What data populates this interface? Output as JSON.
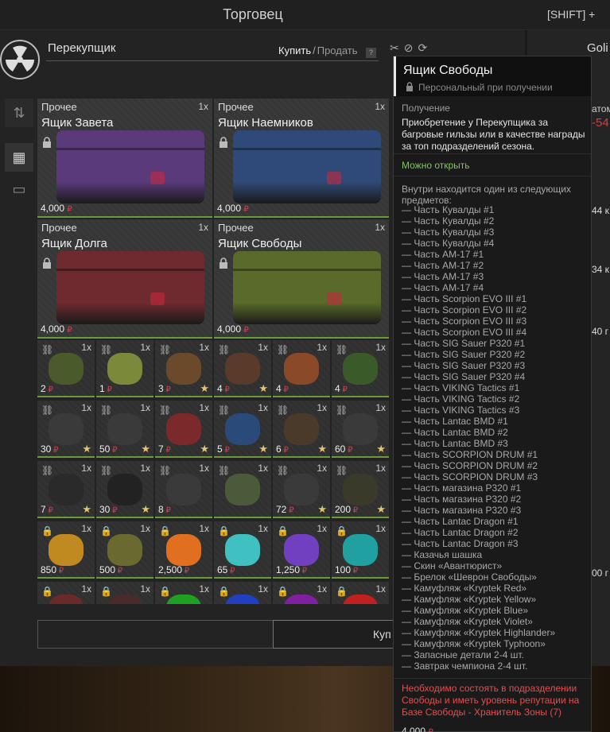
{
  "window": {
    "title": "Торговец",
    "shift_hint": "[SHIFT] +"
  },
  "trader": {
    "name": "Перекупщик",
    "buy": "Купить",
    "slash": "/",
    "sell": "Продать",
    "help": "?"
  },
  "currency_icon": "ruble-sign-icon",
  "big_items": [
    {
      "category": "Прочее",
      "name": "Ящик Завета",
      "qty": "1x",
      "price": "4,000",
      "color": "#5a3a7a"
    },
    {
      "category": "Прочее",
      "name": "Ящик Наемников",
      "qty": "1x",
      "price": "4,000",
      "color": "#2f4a78"
    },
    {
      "category": "Прочее",
      "name": "Ящик Долга",
      "qty": "1x",
      "price": "4,000",
      "color": "#6e2a2e"
    },
    {
      "category": "Прочее",
      "name": "Ящик Свободы",
      "qty": "1x",
      "price": "4,000",
      "color": "#5a6a2a"
    }
  ],
  "small_items": [
    {
      "qty": "1x",
      "price": "2",
      "star": "",
      "color": "#4a5a2a"
    },
    {
      "qty": "1x",
      "price": "1",
      "star": "",
      "color": "#7a8a3a"
    },
    {
      "qty": "1x",
      "price": "3",
      "star": "★",
      "color": "#6a4a2a"
    },
    {
      "qty": "1x",
      "price": "4",
      "star": "★",
      "color": "#5a3a2a"
    },
    {
      "qty": "1x",
      "price": "4",
      "star": "",
      "color": "#8a4a2a"
    },
    {
      "qty": "1x",
      "price": "4",
      "star": "",
      "color": "#3a5a2a"
    },
    {
      "qty": "1x",
      "price": "30",
      "star": "★",
      "color": "#3a3a3a"
    },
    {
      "qty": "1x",
      "price": "50",
      "star": "★",
      "color": "#3a3a3a"
    },
    {
      "qty": "1x",
      "price": "7",
      "star": "★",
      "color": "#7a2a2a"
    },
    {
      "qty": "1x",
      "price": "5",
      "star": "★",
      "color": "#2a4a7a"
    },
    {
      "qty": "1x",
      "price": "6",
      "star": "★",
      "color": "#4a3a2a"
    },
    {
      "qty": "1x",
      "price": "60",
      "star": "★",
      "color": "#3a3a3a"
    },
    {
      "qty": "1x",
      "price": "7",
      "star": "★",
      "color": "#2a2a2a"
    },
    {
      "qty": "1x",
      "price": "30",
      "star": "★",
      "color": "#222222"
    },
    {
      "qty": "1x",
      "price": "8",
      "star": "",
      "color": "#3a3a3a"
    },
    {
      "qty": "1x",
      "price": "",
      "star": "",
      "color": "#4a5a3a"
    },
    {
      "qty": "1x",
      "price": "72",
      "star": "★",
      "color": "#3a3a3a"
    },
    {
      "qty": "1x",
      "price": "200",
      "star": "★",
      "color": "#3a3a2a"
    },
    {
      "qty": "1x",
      "price": "850",
      "star": "",
      "color": "#c08a20"
    },
    {
      "qty": "1x",
      "price": "500",
      "star": "",
      "color": "#6a6a30"
    },
    {
      "qty": "1x",
      "price": "2,500",
      "star": "",
      "color": "#e07020"
    },
    {
      "qty": "1x",
      "price": "65",
      "star": "",
      "color": "#40c0c0"
    },
    {
      "qty": "1x",
      "price": "1,250",
      "star": "",
      "color": "#7040c0"
    },
    {
      "qty": "1x",
      "price": "100",
      "star": "",
      "color": "#20a0a0"
    },
    {
      "qty": "1x",
      "price": "",
      "star": "",
      "color": "#6a2a2a"
    },
    {
      "qty": "1x",
      "price": "",
      "star": "",
      "color": "#4a2a2a"
    },
    {
      "qty": "1x",
      "price": "",
      "star": "",
      "color": "#20a020"
    },
    {
      "qty": "1x",
      "price": "",
      "star": "",
      "color": "#2040c0"
    },
    {
      "qty": "1x",
      "price": "",
      "star": "",
      "color": "#8020a0"
    },
    {
      "qty": "1x",
      "price": "",
      "star": "",
      "color": "#c02020"
    }
  ],
  "buy_button": {
    "label": "Куп"
  },
  "right_panel": {
    "name": "Goli",
    "frag1": "атом",
    "frag2": "-54",
    "frag3": "44 к",
    "frag4": "34 к",
    "frag5": "40 г",
    "frag6": "00 г"
  },
  "tooltip": {
    "title": "Ящик Свободы",
    "personal": "Персональный при получении",
    "obtain_label": "Получение",
    "obtain_text": "Приобретение у Перекупщика за багровые гильзы или в качестве награды за топ подразделений сезона.",
    "can_open": "Можно открыть",
    "inside_text": "Внутри находится один из следующих предметов:",
    "contents": [
      "— Часть Кувалды #1",
      "— Часть Кувалды #2",
      "— Часть Кувалды #3",
      "— Часть Кувалды #4",
      "— Часть AM-17 #1",
      "— Часть AM-17 #2",
      "— Часть AM-17 #3",
      "— Часть AM-17 #4",
      "— Часть Scorpion EVO III #1",
      "— Часть Scorpion EVO III #2",
      "— Часть Scorpion EVO III #3",
      "— Часть Scorpion EVO III #4",
      "— Часть SIG Sauer P320 #1",
      "— Часть SIG Sauer P320 #2",
      "— Часть SIG Sauer P320 #3",
      "— Часть SIG Sauer P320 #4",
      "— Часть VIKING Tactics #1",
      "— Часть VIKING Tactics #2",
      "— Часть VIKING Tactics #3",
      "— Часть Lantac BMD #1",
      "— Часть Lantac BMD #2",
      "— Часть Lantac BMD #3",
      "— Часть SCORPION DRUM #1",
      "— Часть SCORPION DRUM #2",
      "— Часть SCORPION DRUM #3",
      "— Часть магазина P320 #1",
      "— Часть магазина P320 #2",
      "— Часть магазина P320 #3",
      "— Часть Lantac Dragon #1",
      "— Часть Lantac Dragon #2",
      "— Часть Lantac Dragon #3",
      "— Казачья шашка",
      "— Скин «Авантюрист»",
      "— Брелок «Шеврон Свободы»",
      "— Камуфляж «Kryptek Red»",
      "— Камуфляж «Kryptek Yellow»",
      "— Камуфляж «Kryptek Blue»",
      "— Камуфляж «Kryptek Violet»",
      "— Камуфляж «Kryptek Highlander»",
      "— Камуфляж «Kryptek Typhoon»",
      "— Запасные детали 2-4 шт.",
      "— Завтрак чемпиона 2-4 шт."
    ],
    "requirement": "Необходимо состоять в подразделении Свободы и иметь уровень репутации на Базе Свободы - Хранитель Зоны (7)",
    "price": "4,000"
  }
}
